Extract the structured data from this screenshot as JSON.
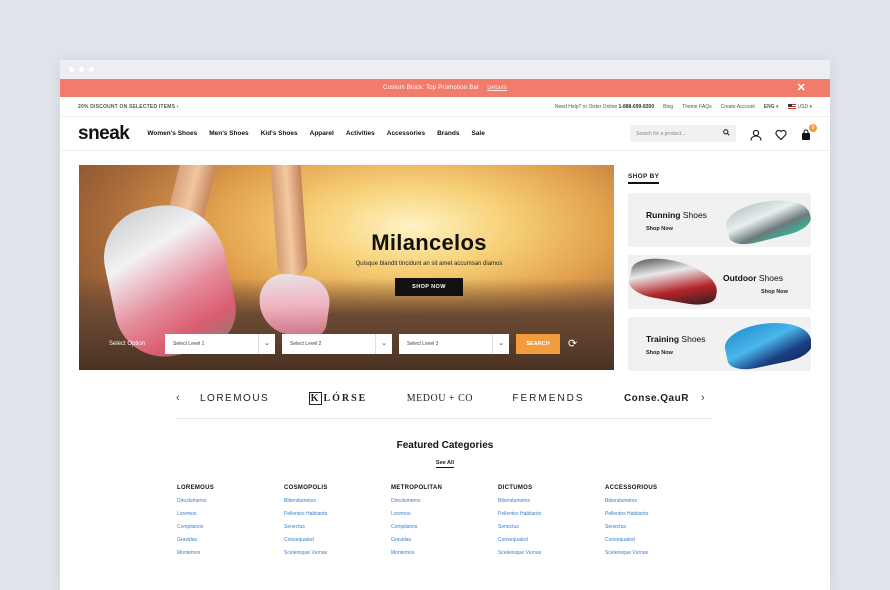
{
  "promo": {
    "text": "Custom Block: Top Promotion Bar",
    "details": "Details"
  },
  "topbar": {
    "discount": "20% DISCOUNT ON SELECTED ITEMS",
    "help": "Need Help? or Order Online",
    "phone": "1-888-699-8300",
    "links": [
      "Blog",
      "Theme FAQs",
      "Create Account"
    ],
    "language": "ENG",
    "currency": "USD"
  },
  "header": {
    "logo": "sneak",
    "nav": [
      "Women's Shoes",
      "Men's Shoes",
      "Kid's Shoes",
      "Apparel",
      "Activities",
      "Accessories",
      "Brands",
      "Sale"
    ],
    "search_placeholder": "Search for a product...",
    "cart_count": "0"
  },
  "hero": {
    "title": "Milancelos",
    "subtitle": "Quisque blandit tincidunt an sit amet accumsan diamos",
    "button": "SHOP NOW",
    "finder_label": "Select Option",
    "selects": [
      "Select Level 1",
      "Select Level 2",
      "Select Level 3"
    ],
    "search_button": "SEARCH"
  },
  "shopby": {
    "title": "SHOP BY",
    "cards": [
      {
        "bold": "Running",
        "rest": " Shoes",
        "cta": "Shop Now"
      },
      {
        "bold": "Outdoor",
        "rest": " Shoes",
        "cta": "Shop Now"
      },
      {
        "bold": "Training",
        "rest": " Shoes",
        "cta": "Shop Now"
      }
    ]
  },
  "brands": {
    "items": [
      "LOREMOUS",
      "LÓRSE",
      "MEDOU + CO",
      "FERMENDS",
      "Conse.QauR"
    ],
    "k_letter": "K"
  },
  "featured": {
    "title": "Featured Categories",
    "see_all": "See All",
    "columns": [
      {
        "title": "LOREMOUS",
        "links": [
          "Dincdumeros",
          "Loremos",
          "Complianos",
          "Gravidas",
          "Montemos"
        ]
      },
      {
        "title": "COSMOPOLIS",
        "links": [
          "Bibendumetos",
          "Pellentes Habitanto",
          "Senectus",
          "Consequatod",
          "Scelerisque Vurnas"
        ]
      },
      {
        "title": "METROPOLITAN",
        "links": [
          "Dincdumeros",
          "Loremos",
          "Complianos",
          "Gravidas",
          "Montemos"
        ]
      },
      {
        "title": "DICTUMOS",
        "links": [
          "Bibendumetos",
          "Pellentes Habitanto",
          "Senectus",
          "Consequatod",
          "Scelerisque Vurnas"
        ]
      },
      {
        "title": "ACCESSORIOUS",
        "links": [
          "Bibendumetos",
          "Pellentes Habitanto",
          "Senectus",
          "Consequatod",
          "Scelerisque Vurnas"
        ]
      }
    ]
  },
  "colors": {
    "promo": "#f27c6c",
    "accent": "#f39c3c",
    "link": "#3a7fc6"
  }
}
